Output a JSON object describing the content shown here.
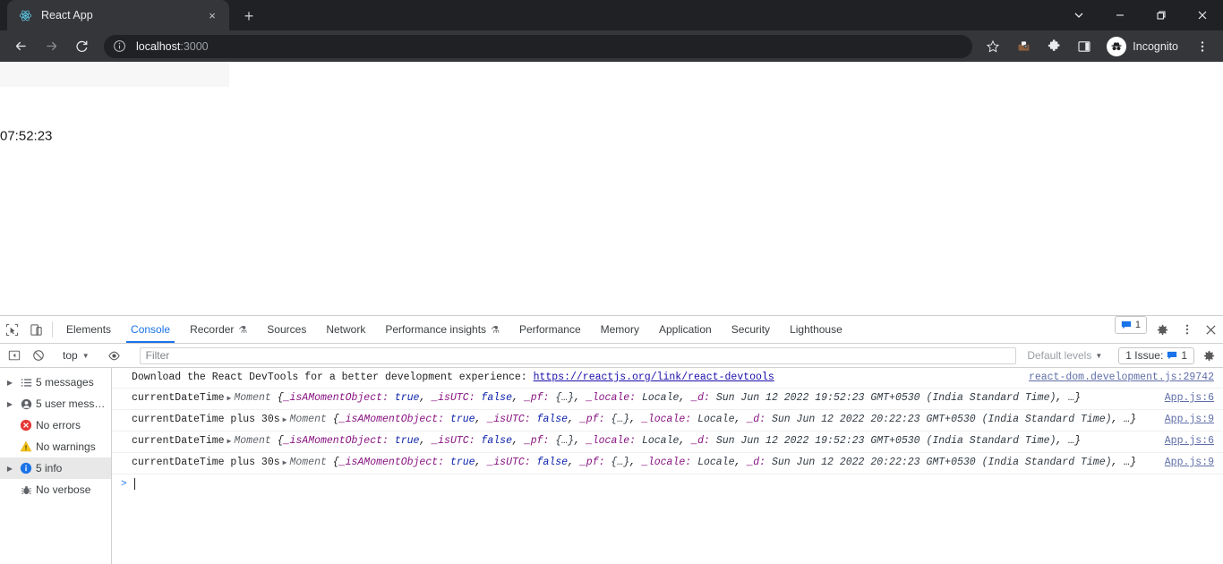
{
  "browser": {
    "tab": {
      "title": "React App",
      "favicon": "react-logo-icon",
      "close": "×"
    },
    "newtab_label": "+",
    "window_controls": {
      "tab_search": "chevron-down-icon",
      "minimize": "minimize-icon",
      "maximize": "maximize-icon",
      "close": "close-icon"
    },
    "toolbar": {
      "back": "back-arrow-icon",
      "forward": "forward-arrow-icon",
      "reload": "reload-icon",
      "site_info": "info-circle-icon",
      "url_host": "localhost",
      "url_port": ":3000",
      "bookmark": "star-icon",
      "extension_one": "extension-icon",
      "extensions": "puzzle-piece-icon",
      "side_panel": "side-panel-icon",
      "incognito_label": "Incognito",
      "menu": "three-dot-menu-icon"
    }
  },
  "page": {
    "clock": "07:52:23"
  },
  "devtools": {
    "left_icons": {
      "inspect": "inspect-element-icon",
      "device": "device-toolbar-icon"
    },
    "tabs": [
      {
        "label": "Elements",
        "active": false,
        "beaker": false
      },
      {
        "label": "Console",
        "active": true,
        "beaker": false
      },
      {
        "label": "Recorder",
        "active": false,
        "beaker": true
      },
      {
        "label": "Sources",
        "active": false,
        "beaker": false
      },
      {
        "label": "Network",
        "active": false,
        "beaker": false
      },
      {
        "label": "Performance insights",
        "active": false,
        "beaker": true
      },
      {
        "label": "Performance",
        "active": false,
        "beaker": false
      },
      {
        "label": "Memory",
        "active": false,
        "beaker": false
      },
      {
        "label": "Application",
        "active": false,
        "beaker": false
      },
      {
        "label": "Security",
        "active": false,
        "beaker": false
      },
      {
        "label": "Lighthouse",
        "active": false,
        "beaker": false
      }
    ],
    "right_controls": {
      "issues_count": "1",
      "settings": "gear-icon",
      "more": "three-dot-menu-icon",
      "close": "close-icon"
    },
    "filterbar": {
      "sidebar_toggle": "console-sidebar-toggle-icon",
      "clear": "clear-console-icon",
      "context": "top",
      "eye": "live-expression-icon",
      "filter_value": "",
      "filter_placeholder": "Filter",
      "levels_label": "Default levels",
      "issue_label": "1 Issue:",
      "issue_count": "1",
      "settings": "gear-icon"
    },
    "sidebar": [
      {
        "label": "5 messages",
        "icon": "list-icon",
        "triangle": true,
        "selected": false
      },
      {
        "label": "5 user mess…",
        "icon": "user-icon",
        "triangle": true,
        "selected": false
      },
      {
        "label": "No errors",
        "icon": "error-icon",
        "triangle": false,
        "selected": false
      },
      {
        "label": "No warnings",
        "icon": "warning-icon",
        "triangle": false,
        "selected": false
      },
      {
        "label": "5 info",
        "icon": "info-icon",
        "triangle": true,
        "selected": true
      },
      {
        "label": "No verbose",
        "icon": "bug-icon",
        "triangle": false,
        "selected": false
      }
    ],
    "console_rows": [
      {
        "kind": "link-message",
        "text": "Download the React DevTools for a better development experience: ",
        "link": "https://reactjs.org/link/react-devtools",
        "source": "react-dom.development.js:29742"
      },
      {
        "kind": "object",
        "label": "currentDateTime",
        "class_name": "Moment",
        "date": "Sun Jun 12 2022 19:52:23 GMT+0530 (India Standard Time)",
        "source": "App.js:6"
      },
      {
        "kind": "object",
        "label": "currentDateTime plus 30s",
        "class_name": "Moment",
        "date": "Sun Jun 12 2022 20:22:23 GMT+0530 (India Standard Time)",
        "source": "App.js:9"
      },
      {
        "kind": "object",
        "label": "currentDateTime",
        "class_name": "Moment",
        "date": "Sun Jun 12 2022 19:52:23 GMT+0530 (India Standard Time)",
        "source": "App.js:6"
      },
      {
        "kind": "object",
        "label": "currentDateTime plus 30s",
        "class_name": "Moment",
        "date": "Sun Jun 12 2022 20:22:23 GMT+0530 (India Standard Time)",
        "source": "App.js:9"
      }
    ],
    "object_props": {
      "open_brace": "{",
      "p1": "_isAMomentObject:",
      "v1": "true",
      "p2": "_isUTC:",
      "v2": "false",
      "p3": "_pf:",
      "v3": "{…}",
      "p4": "_locale:",
      "v4": "Locale",
      "p5": "_d:",
      "tail": ", …}",
      "comma": ", "
    },
    "prompt": {
      "caret": ">"
    }
  },
  "colors": {
    "chrome_dark": "#202124",
    "chrome_toolbar": "#35363a",
    "accent_blue": "#1a73e8",
    "link_blue": "#1a0dab",
    "prop_purple": "#881280",
    "bool_blue": "#0d22aa",
    "error_red": "#e53935",
    "warning_yellow": "#f5c518",
    "react_cyan": "#61dafb"
  }
}
